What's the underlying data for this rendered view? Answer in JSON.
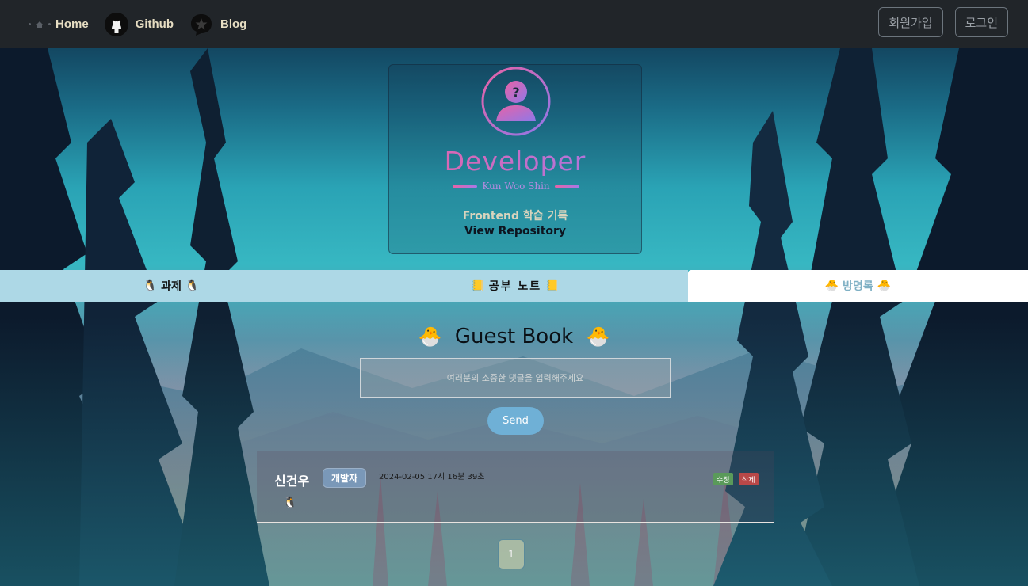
{
  "nav": {
    "home_label": "Home",
    "github_label": "Github",
    "blog_label": "Blog",
    "signup_label": "회원가입",
    "login_label": "로그인"
  },
  "profile": {
    "title": "Developer",
    "name": "Kun Woo Shin",
    "tagline": "Frontend 학습 기록",
    "repo_link": "View Repository"
  },
  "tabs": [
    {
      "label": "과제",
      "icon": "🐧",
      "active": false
    },
    {
      "label": "공부 노트",
      "icon": "📒",
      "active": false
    },
    {
      "label": "방명록",
      "icon": "🐣",
      "active": true
    }
  ],
  "guestbook": {
    "title": "Guest Book",
    "title_icon": "🐣",
    "input_placeholder": "여러분의 소중한 댓글을 입력해주세요",
    "send_label": "Send"
  },
  "comments": [
    {
      "author": "신건우",
      "badge": "개발자",
      "date": "2024-02-05 17시 16분 39초",
      "body": "🐧",
      "edit_label": "수정",
      "delete_label": "삭제"
    }
  ],
  "pagination": {
    "current": "1"
  },
  "colors": {
    "navbar": "#212529",
    "tab_bg": "#add8e6",
    "tab_active_bg": "#ffffff",
    "send_button": "#6fb0d6",
    "accent_gradient_start": "#e862a6",
    "accent_gradient_end": "#a57ae8"
  }
}
